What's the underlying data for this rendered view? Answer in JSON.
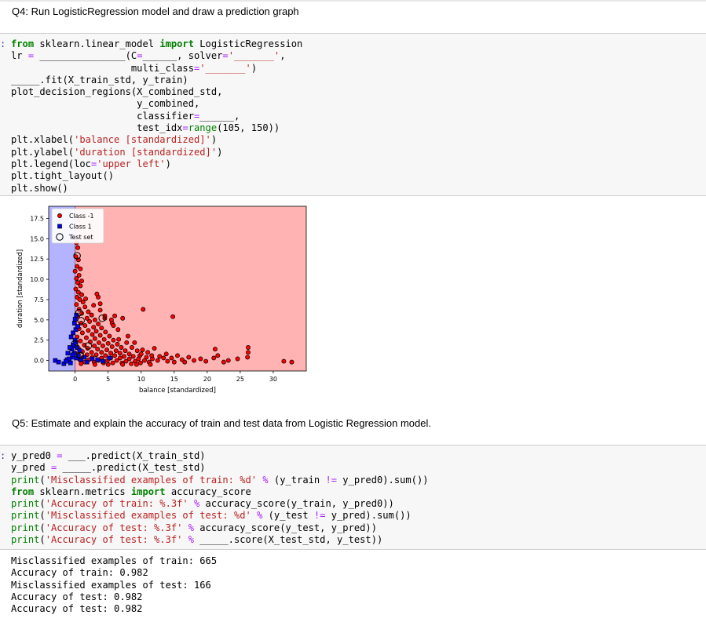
{
  "q4": {
    "title": "Q4: Run LogisticRegression model and draw a prediction graph"
  },
  "cell1": {
    "prompt": ":",
    "lines": [
      "from sklearn.linear_model import LogisticRegression",
      "lr = _______________(C=______, solver='_______',",
      "                     multi_class='_______')",
      "_____.fit(X_train_std, y_train)",
      "plot_decision_regions(X_combined_std,",
      "                      y_combined,",
      "                      classifier=______,",
      "                      test_idx=range(105, 150))",
      "plt.xlabel('balance [standardized]')",
      "plt.ylabel('duration [standardized]')",
      "plt.legend(loc='upper left')",
      "plt.tight_layout()",
      "plt.show()"
    ]
  },
  "chart_data": {
    "type": "scatter",
    "title": "",
    "xlabel": "balance [standardized]",
    "ylabel": "duration [standardized]",
    "xlim": [
      -4,
      35
    ],
    "ylim": [
      -1.3,
      19
    ],
    "xticks": [
      "0",
      "5",
      "10",
      "15",
      "20",
      "25",
      "30"
    ],
    "yticks": [
      "0.0",
      "2.5",
      "5.0",
      "7.5",
      "10.0",
      "12.5",
      "15.0",
      "17.5"
    ],
    "decision_boundary_x": 0,
    "legend": {
      "placement": "upper left",
      "entries": [
        "Class -1",
        "Class 1",
        "Test set"
      ]
    },
    "region_colors": {
      "class_-1": "#ffb3b3",
      "class_1": "#b3b3ff"
    },
    "marker_colors": {
      "class_-1": "#ff0000",
      "class_1": "#0000ff"
    },
    "series": [
      {
        "name": "Class -1",
        "points": [
          [
            0.2,
            14.5
          ],
          [
            0.4,
            13.9
          ],
          [
            0.1,
            12.8
          ],
          [
            0.5,
            12.4
          ],
          [
            0.3,
            11.6
          ],
          [
            0.0,
            11.0
          ],
          [
            0.6,
            10.5
          ],
          [
            0.2,
            10.1
          ],
          [
            0.4,
            9.6
          ],
          [
            0.8,
            9.2
          ],
          [
            0.1,
            8.8
          ],
          [
            0.5,
            8.4
          ],
          [
            1.0,
            8.1
          ],
          [
            0.3,
            7.8
          ],
          [
            0.7,
            7.5
          ],
          [
            1.2,
            7.2
          ],
          [
            0.2,
            6.9
          ],
          [
            1.5,
            6.6
          ],
          [
            0.6,
            6.3
          ],
          [
            2.0,
            6.0
          ],
          [
            1.0,
            5.8
          ],
          [
            2.5,
            5.6
          ],
          [
            0.4,
            5.4
          ],
          [
            1.8,
            5.2
          ],
          [
            3.0,
            5.0
          ],
          [
            2.2,
            4.8
          ],
          [
            0.9,
            4.6
          ],
          [
            3.5,
            4.5
          ],
          [
            1.5,
            4.3
          ],
          [
            2.8,
            4.1
          ],
          [
            4.0,
            4.0
          ],
          [
            0.6,
            3.9
          ],
          [
            2.0,
            3.7
          ],
          [
            3.2,
            3.6
          ],
          [
            4.6,
            3.5
          ],
          [
            1.1,
            3.4
          ],
          [
            2.6,
            3.2
          ],
          [
            3.8,
            3.1
          ],
          [
            5.2,
            3.0
          ],
          [
            0.3,
            2.9
          ],
          [
            1.7,
            2.8
          ],
          [
            3.0,
            2.7
          ],
          [
            4.4,
            2.6
          ],
          [
            5.8,
            2.5
          ],
          [
            0.8,
            2.4
          ],
          [
            2.3,
            2.3
          ],
          [
            3.6,
            2.2
          ],
          [
            5.0,
            2.1
          ],
          [
            6.4,
            2.0
          ],
          [
            1.4,
            1.9
          ],
          [
            2.9,
            1.8
          ],
          [
            4.2,
            1.8
          ],
          [
            5.6,
            1.7
          ],
          [
            7.0,
            1.6
          ],
          [
            0.5,
            1.5
          ],
          [
            1.9,
            1.5
          ],
          [
            3.4,
            1.4
          ],
          [
            4.8,
            1.3
          ],
          [
            6.2,
            1.2
          ],
          [
            7.6,
            1.2
          ],
          [
            1.1,
            1.1
          ],
          [
            2.5,
            1.0
          ],
          [
            4.0,
            1.0
          ],
          [
            5.4,
            0.9
          ],
          [
            6.8,
            0.9
          ],
          [
            8.2,
            0.8
          ],
          [
            0.4,
            0.8
          ],
          [
            1.8,
            0.7
          ],
          [
            3.2,
            0.7
          ],
          [
            4.6,
            0.6
          ],
          [
            6.0,
            0.6
          ],
          [
            7.4,
            0.5
          ],
          [
            8.8,
            0.5
          ],
          [
            9.8,
            0.6
          ],
          [
            1.2,
            0.4
          ],
          [
            2.6,
            0.4
          ],
          [
            4.0,
            0.3
          ],
          [
            5.4,
            0.3
          ],
          [
            6.8,
            0.3
          ],
          [
            8.2,
            0.2
          ],
          [
            9.6,
            0.2
          ],
          [
            10.8,
            0.4
          ],
          [
            0.7,
            0.1
          ],
          [
            2.1,
            0.1
          ],
          [
            3.5,
            0.0
          ],
          [
            4.9,
            0.0
          ],
          [
            6.3,
            0.0
          ],
          [
            7.7,
            -0.1
          ],
          [
            9.1,
            -0.1
          ],
          [
            10.5,
            0.0
          ],
          [
            11.7,
            0.2
          ],
          [
            1.5,
            -0.2
          ],
          [
            2.9,
            -0.2
          ],
          [
            4.3,
            -0.3
          ],
          [
            5.7,
            -0.3
          ],
          [
            7.1,
            -0.3
          ],
          [
            8.5,
            -0.4
          ],
          [
            9.9,
            -0.3
          ],
          [
            11.2,
            -0.2
          ],
          [
            12.5,
            0.0
          ],
          [
            13.4,
            0.3
          ],
          [
            14.0,
            -0.1
          ],
          [
            15.0,
            -0.2
          ],
          [
            16.2,
            0.1
          ],
          [
            0.9,
            -0.4
          ],
          [
            3.0,
            -0.5
          ],
          [
            5.0,
            -0.5
          ],
          [
            7.2,
            -0.5
          ],
          [
            9.3,
            -0.5
          ],
          [
            11.4,
            -0.5
          ],
          [
            12.0,
            1.5
          ],
          [
            11.0,
            1.0
          ],
          [
            10.2,
            1.3
          ],
          [
            9.0,
            2.2
          ],
          [
            8.0,
            3.0
          ],
          [
            6.5,
            3.8
          ],
          [
            5.6,
            4.6
          ],
          [
            4.5,
            5.2
          ],
          [
            3.8,
            6.2
          ],
          [
            2.8,
            6.8
          ],
          [
            1.6,
            7.6
          ],
          [
            1.0,
            9.8
          ],
          [
            0.8,
            11.3
          ],
          [
            3.8,
            7.0
          ],
          [
            4.5,
            5.5
          ],
          [
            5.5,
            5.0
          ],
          [
            6.0,
            5.5
          ],
          [
            5.8,
            4.3
          ],
          [
            6.6,
            2.6
          ],
          [
            7.8,
            2.2
          ],
          [
            8.6,
            1.6
          ],
          [
            9.4,
            1.2
          ],
          [
            10.0,
            0.8
          ],
          [
            11.6,
            0.6
          ],
          [
            12.8,
            0.5
          ],
          [
            13.8,
            0.8
          ],
          [
            14.6,
            0.3
          ],
          [
            15.5,
            0.6
          ],
          [
            16.6,
            -0.2
          ],
          [
            17.2,
            0.4
          ],
          [
            18.0,
            0.0
          ],
          [
            19.0,
            0.2
          ],
          [
            19.8,
            -0.1
          ],
          [
            21.0,
            0.3
          ],
          [
            21.6,
            0.6
          ],
          [
            21.2,
            1.4
          ],
          [
            22.5,
            -0.2
          ],
          [
            23.2,
            0.0
          ],
          [
            24.6,
            0.2
          ],
          [
            26.1,
            0.4
          ],
          [
            26.2,
            1.0
          ],
          [
            26.2,
            1.6
          ],
          [
            31.6,
            -0.1
          ],
          [
            32.8,
            -0.2
          ],
          [
            10.3,
            6.3
          ],
          [
            14.8,
            5.4
          ],
          [
            7.2,
            5.2
          ],
          [
            3.5,
            7.8
          ],
          [
            3.3,
            8.2
          ]
        ]
      },
      {
        "name": "Class 1",
        "points": [
          [
            -3.0,
            0.0
          ],
          [
            -2.5,
            -0.2
          ],
          [
            -1.7,
            -0.4
          ],
          [
            -1.2,
            0.1
          ],
          [
            -0.7,
            -0.3
          ],
          [
            -0.4,
            0.4
          ],
          [
            -0.1,
            0.9
          ],
          [
            -0.5,
            1.4
          ],
          [
            -0.2,
            1.9
          ],
          [
            0.0,
            2.5
          ],
          [
            -0.6,
            2.9
          ],
          [
            -0.3,
            3.4
          ],
          [
            0.1,
            3.8
          ],
          [
            -0.1,
            4.6
          ],
          [
            0.0,
            5.1
          ],
          [
            -0.4,
            0.7
          ],
          [
            -0.9,
            0.2
          ],
          [
            -1.4,
            -0.1
          ],
          [
            0.2,
            0.3
          ],
          [
            0.3,
            1.6
          ],
          [
            0.1,
            2.2
          ],
          [
            0.5,
            0.6
          ],
          [
            0.7,
            1.2
          ],
          [
            0.9,
            0.1
          ],
          [
            1.4,
            0.4
          ],
          [
            1.8,
            -0.2
          ],
          [
            2.6,
            0.2
          ],
          [
            3.4,
            0.1
          ],
          [
            4.2,
            -0.1
          ],
          [
            5.2,
            0.3
          ],
          [
            -0.8,
            1.6
          ],
          [
            -1.1,
            0.9
          ],
          [
            0.4,
            4.2
          ],
          [
            0.2,
            5.6
          ]
        ]
      }
    ],
    "test_set_circles": [
      [
        0.3,
        12.9
      ],
      [
        0.6,
        5.9
      ],
      [
        0.9,
        4.9
      ],
      [
        4.1,
        5.2
      ],
      [
        2.0,
        1.8
      ],
      [
        0.8,
        0.6
      ],
      [
        -0.1,
        2.0
      ]
    ]
  },
  "q5": {
    "title": "Q5: Estimate and explain the accuracy of train and test data from Logistic Regression model."
  },
  "cell2": {
    "prompt": ":",
    "lines": [
      "y_pred0 = ___.predict(X_train_std)",
      "y_pred = _____.predict(X_test_std)",
      "print('Misclassified examples of train: %d' % (y_train != y_pred0).sum())",
      "from sklearn.metrics import accuracy_score",
      "print('Accuracy of train: %.3f' % accuracy_score(y_train, y_pred0))",
      "print('Misclassified examples of test: %d' % (y_test != y_pred).sum())",
      "print('Accuracy of test: %.3f' % accuracy_score(y_test, y_pred))",
      "print('Accuracy of test: %.3f' % _____.score(X_test_std, y_test))"
    ]
  },
  "output2": {
    "lines": [
      "Misclassified examples of train: 665",
      "Accuracy of train: 0.982",
      "Misclassified examples of test: 166",
      "Accuracy of test: 0.982",
      "Accuracy of test: 0.982"
    ]
  }
}
